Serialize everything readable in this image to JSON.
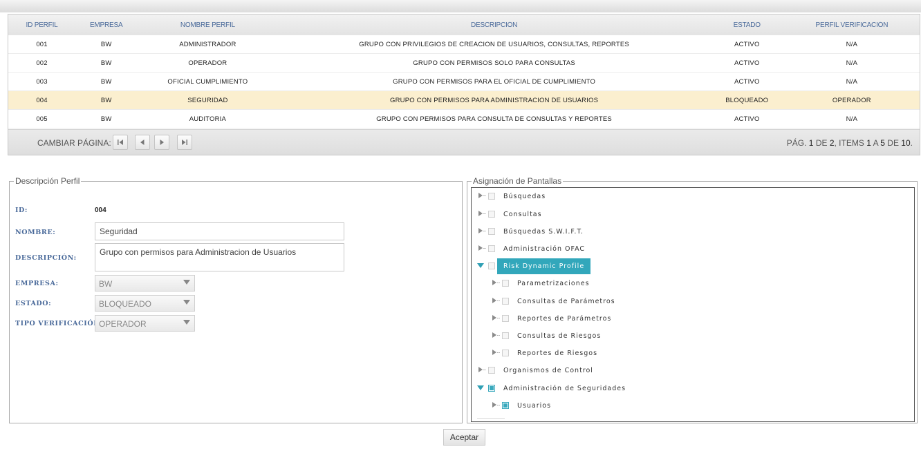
{
  "grid": {
    "headers": [
      "ID PERFIL",
      "EMPRESA",
      "NOMBRE PERFIL",
      "DESCRIPCIÓN",
      "ESTADO",
      "PERFIL VERIFICACIÓN"
    ],
    "rows": [
      [
        "001",
        "BW",
        "ADMINISTRADOR",
        "GRUPO CON PRIVILEGIOS DE CREACION DE USUARIOS, CONSULTAS, REPORTES",
        "ACTIVO",
        "N/A"
      ],
      [
        "002",
        "BW",
        "OPERADOR",
        "GRUPO CON PERMISOS SOLO PARA CONSULTAS",
        "ACTIVO",
        "N/A"
      ],
      [
        "003",
        "BW",
        "OFICIAL CUMPLIMIENTO",
        "GRUPO CON PERMISOS PARA EL OFICIAL DE CUMPLIMIENTO",
        "ACTIVO",
        "N/A"
      ],
      [
        "004",
        "BW",
        "SEGURIDAD",
        "GRUPO CON PERMISOS PARA ADMINISTRACION DE USUARIOS",
        "BLOQUEADO",
        "OPERADOR"
      ],
      [
        "005",
        "BW",
        "AUDITORIA",
        "GRUPO CON PERMISOS PARA CONSULTA DE CONSULTAS Y REPORTES",
        "ACTIVO",
        "N/A"
      ]
    ],
    "selected_row": 3
  },
  "pager": {
    "label": "CAMBIAR PÁGINA:",
    "pag_prefix": "PÁG.",
    "page": "1",
    "de": "DE",
    "pages": "2",
    "items_prefix": ", ITEMS",
    "from": "1",
    "a": "A",
    "to": "5",
    "de2": "DE",
    "total": "10",
    "end": ".",
    "first_icon": "first-page-icon",
    "prev_icon": "prev-page-icon",
    "next_icon": "next-page-icon",
    "last_icon": "last-page-icon"
  },
  "perfil": {
    "legend": "Descripción Perfil",
    "id_label": "ID:",
    "id_value": "004",
    "nombre_label": "NOMBRE:",
    "nombre_value": "Seguridad",
    "descripcion_label": "DESCRIPCIÓN:",
    "descripcion_value": "Grupo con permisos para Administracion de Usuarios",
    "empresa_label": "EMPRESA:",
    "empresa_value": "BW",
    "estado_label": "ESTADO:",
    "estado_value": "BLOQUEADO",
    "tipo_label": "TIPO VERIFICACIÓN:",
    "tipo_value": "OPERADOR"
  },
  "pantallas": {
    "legend": "Asignación de Pantallas",
    "nodes": [
      {
        "label": "Búsquedas",
        "level": 0,
        "state": "closed",
        "checked": false
      },
      {
        "label": "Consultas",
        "level": 0,
        "state": "closed",
        "checked": false
      },
      {
        "label": "Búsquedas S.W.I.F.T.",
        "level": 0,
        "state": "closed",
        "checked": false
      },
      {
        "label": "Administración OFAC",
        "level": 0,
        "state": "closed",
        "checked": false
      },
      {
        "label": "Risk Dynamic Profile",
        "level": 0,
        "state": "open",
        "checked": false,
        "highlighted": true
      },
      {
        "label": "Parametrizaciones",
        "level": 1,
        "state": "closed",
        "checked": false
      },
      {
        "label": "Consultas de Parámetros",
        "level": 1,
        "state": "closed",
        "checked": false
      },
      {
        "label": "Reportes de Parámetros",
        "level": 1,
        "state": "closed",
        "checked": false
      },
      {
        "label": "Consultas de Riesgos",
        "level": 1,
        "state": "closed",
        "checked": false
      },
      {
        "label": "Reportes de Riesgos",
        "level": 1,
        "state": "closed",
        "checked": false
      },
      {
        "label": "Organismos de Control",
        "level": 0,
        "state": "closed",
        "checked": false
      },
      {
        "label": "Administración de Seguridades",
        "level": 0,
        "state": "open",
        "checked": true
      },
      {
        "label": "Usuarios",
        "level": 1,
        "state": "closed",
        "checked": true
      }
    ]
  },
  "accept_label": "Aceptar"
}
